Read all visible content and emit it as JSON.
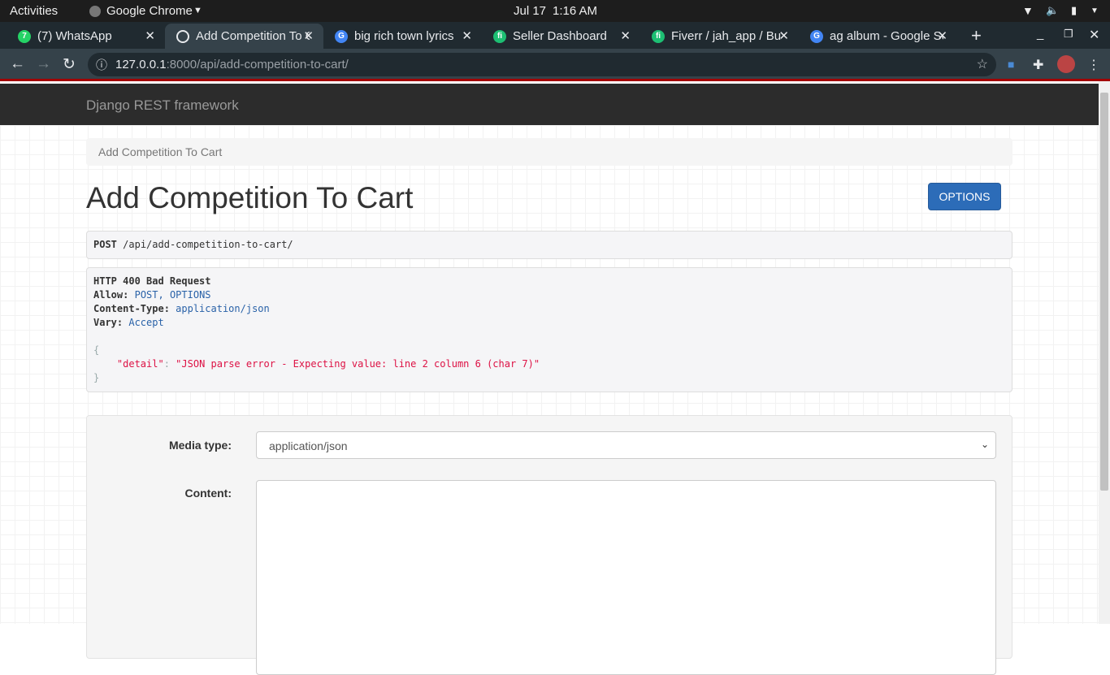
{
  "system": {
    "activities": "Activities",
    "app": "Google Chrome",
    "date": "Jul 17",
    "time": "1:16 AM"
  },
  "tabs": [
    {
      "label": "(7) WhatsApp",
      "color": "#25d366",
      "glyph": "7"
    },
    {
      "label": "Add Competition To Cart",
      "color": "#e8eaed",
      "glyph": ""
    },
    {
      "label": "big rich town lyrics",
      "color": "#4285f4",
      "glyph": "G"
    },
    {
      "label": "Seller Dashboard",
      "color": "#1dbf73",
      "glyph": "fi"
    },
    {
      "label": "Fiverr / jah_app / Bu",
      "color": "#1dbf73",
      "glyph": "fi"
    },
    {
      "label": "ag album - Google Search",
      "color": "#4285f4",
      "glyph": "G"
    }
  ],
  "url": {
    "host": "127.0.0.1",
    "rest": ":8000/api/add-competition-to-cart/"
  },
  "brand": "Django REST framework",
  "breadcrumb": "Add Competition To Cart",
  "title": "Add Competition To Cart",
  "options_label": "OPTIONS",
  "request": {
    "method": "POST",
    "path": "/api/add-competition-to-cart/"
  },
  "response": {
    "status": "HTTP 400 Bad Request",
    "allow_key": "Allow:",
    "allow": "POST, OPTIONS",
    "ct_key": "Content-Type:",
    "ct": "application/json",
    "vary_key": "Vary:",
    "vary": "Accept",
    "open": "{",
    "key": "\"detail\"",
    "colon": ":",
    "value": "\"JSON parse error - Expecting value: line 2 column 6 (char 7)\"",
    "close": "}"
  },
  "form": {
    "media_label": "Media type:",
    "media_value": "application/json",
    "content_label": "Content:"
  }
}
